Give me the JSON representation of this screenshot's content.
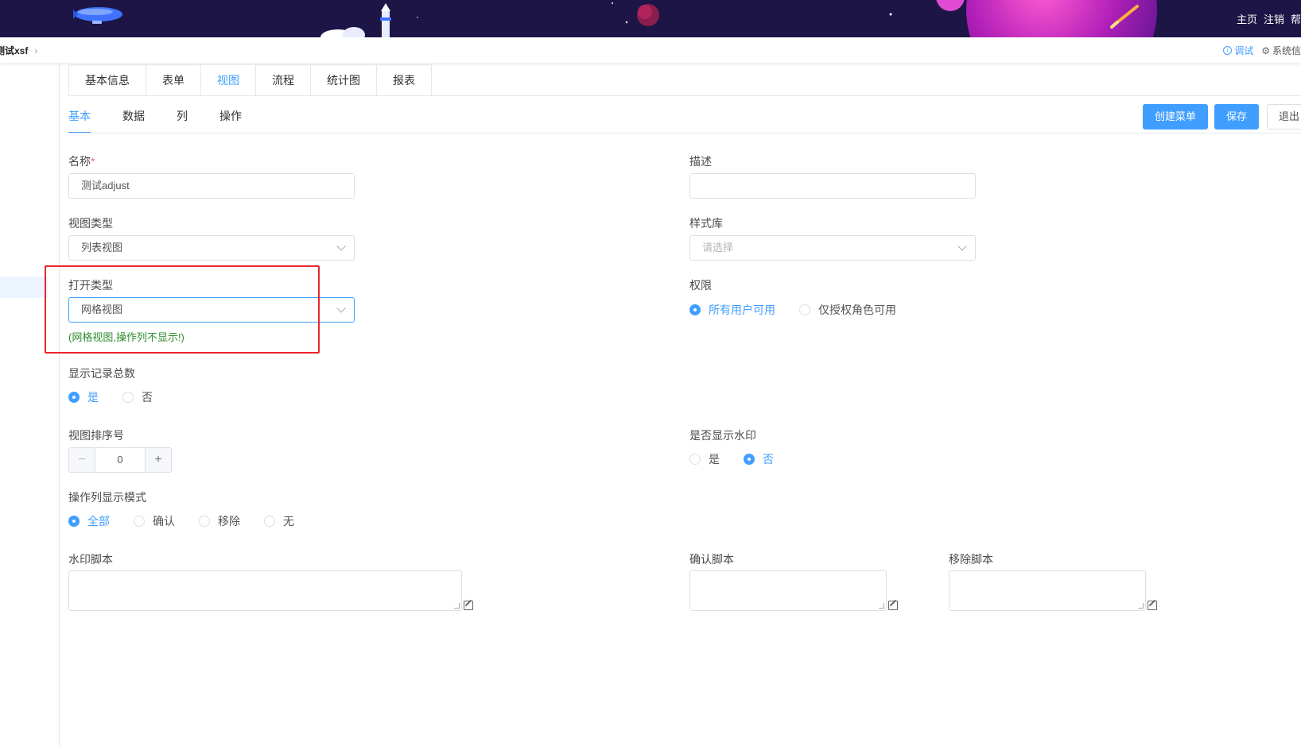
{
  "header": {
    "nav": [
      "主页",
      "注销",
      "帮"
    ]
  },
  "breadcrumb": {
    "current": "测试xsf",
    "debug_label": "调试",
    "system_label": "系统信"
  },
  "tabs": [
    "基本信息",
    "表单",
    "视图",
    "流程",
    "统计图",
    "报表"
  ],
  "active_tab": "视图",
  "subtabs": [
    "基本",
    "数据",
    "列",
    "操作"
  ],
  "active_subtab": "基本",
  "actions": {
    "create_menu": "创建菜单",
    "save": "保存",
    "exit": "退出"
  },
  "form": {
    "name": {
      "label": "名称",
      "required_mark": "*",
      "value": "测试adjust"
    },
    "description": {
      "label": "描述",
      "value": ""
    },
    "view_type": {
      "label": "视图类型",
      "value": "列表视图"
    },
    "style_lib": {
      "label": "样式库",
      "placeholder": "请选择"
    },
    "open_type": {
      "label": "打开类型",
      "value": "网格视图",
      "hint": "(网格视图,操作列不显示!)"
    },
    "permission": {
      "label": "权限",
      "options": [
        "所有用户可用",
        "仅授权角色可用"
      ],
      "selected": "所有用户可用"
    },
    "show_total": {
      "label": "显示记录总数",
      "options": [
        "是",
        "否"
      ],
      "selected": "是"
    },
    "sort_no": {
      "label": "视图排序号",
      "value": "0",
      "minus": "−",
      "plus": "+"
    },
    "watermark": {
      "label": "是否显示水印",
      "options": [
        "是",
        "否"
      ],
      "selected": "否"
    },
    "op_mode": {
      "label": "操作列显示模式",
      "options": [
        "全部",
        "确认",
        "移除",
        "无"
      ],
      "selected": "全部"
    },
    "watermark_script": {
      "label": "水印脚本"
    },
    "confirm_script": {
      "label": "确认脚本"
    },
    "remove_script": {
      "label": "移除脚本"
    }
  },
  "theme": {
    "primary": "#409eff",
    "banner_bg": "#1d1546",
    "highlight_border": "#e8262b",
    "hint_color": "#2e8b2e"
  }
}
